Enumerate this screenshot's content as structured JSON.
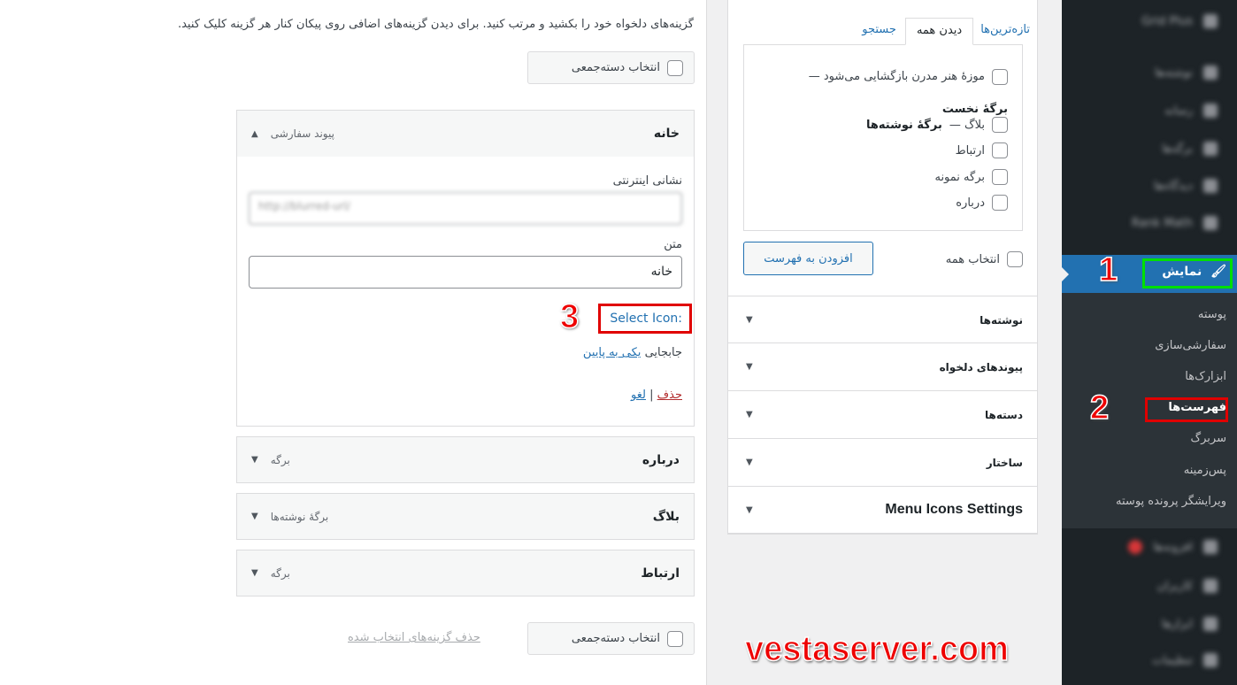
{
  "instructions": "گزینه‌های دلخواه خود را بکشید و مرتب کنید. برای دیدن گزینه‌های اضافی روی پیکان کنار هر گزینه کلیک کنید.",
  "bulk_select": "انتخاب دسته‌جمعی",
  "remove_selected": "حذف گزینه‌های انتخاب شده",
  "menu_items": [
    {
      "title": "خانه",
      "type": "پیوند سفارشی",
      "expanded": true
    },
    {
      "title": "درباره",
      "type": "برگه"
    },
    {
      "title": "بلاگ",
      "type": "برگهٔ نوشته‌ها"
    },
    {
      "title": "ارتباط",
      "type": "برگه"
    }
  ],
  "edit": {
    "url_label": "نشانی اینترنتی",
    "url_value": "http://blurred-url/",
    "text_label": "متن",
    "text_value": "خانه",
    "icon_label": "Icon:",
    "icon_link": "Select",
    "move_label": "جابجایی",
    "move_link": "یکی به پایین",
    "delete": "حذف",
    "cancel": "لغو",
    "sep": "|"
  },
  "pages_box": {
    "tabs": [
      "تازه‌ترین‌ها",
      "دیدن همه",
      "جستجو"
    ],
    "active_tab": 1,
    "items": [
      {
        "label": "موزهٔ هنر مدرن بازگشایی می‌شود —",
        "bold": "برگهٔ نخست"
      },
      {
        "label": "بلاگ —",
        "bold": "برگهٔ نوشته‌ها"
      },
      {
        "label": "ارتباط"
      },
      {
        "label": "برگه نمونه"
      },
      {
        "label": "درباره"
      }
    ],
    "select_all": "انتخاب همه",
    "add_button": "افزودن به فهرست"
  },
  "sections": [
    "نوشته‌ها",
    "پیوندهای دلخواه",
    "دسته‌ها",
    "ساختار",
    "Menu Icons Settings"
  ],
  "sidebar": {
    "active": "نمایش",
    "submenu": [
      "پوسته",
      "سفارشی‌سازی",
      "ابزارک‌ها",
      "فهرست‌ها",
      "سربرگ",
      "پس‌زمینه",
      "ویرایشگر پرونده پوسته"
    ],
    "current": "فهرست‌ها",
    "blurred_top": [
      "Grid Plus",
      "نوشته‌ها",
      "رسانه",
      "برگه‌ها",
      "دیدگاه‌ها",
      "Rank Math"
    ],
    "blurred_bottom": [
      "افزونه‌ها",
      "کاربران",
      "ابزارها",
      "تنظیمات"
    ]
  },
  "annotations": {
    "n1": "1",
    "n2": "2",
    "n3": "3",
    "watermark": "vestaserver.com"
  },
  "colors": {
    "accent": "#2271b1",
    "sidebar": "#1d2327",
    "annotation_red": "#e00000",
    "annotation_green": "#00e000"
  }
}
